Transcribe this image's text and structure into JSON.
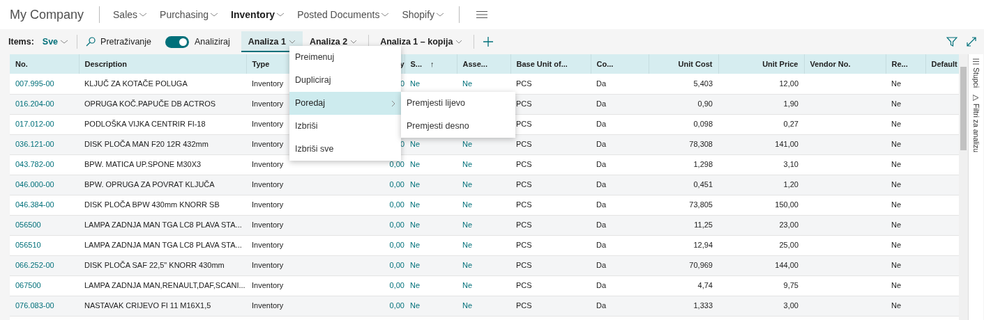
{
  "header": {
    "company": "My Company",
    "nav": [
      {
        "label": "Sales",
        "selected": false
      },
      {
        "label": "Purchasing",
        "selected": false
      },
      {
        "label": "Inventory",
        "selected": true
      },
      {
        "label": "Posted Documents",
        "selected": false
      },
      {
        "label": "Shopify",
        "selected": false
      }
    ]
  },
  "toolbar": {
    "items_label": "Items:",
    "view": "Sve",
    "search": "Pretraživanje",
    "analyze": {
      "label": "Analiziraj",
      "on": true
    },
    "tabs": [
      {
        "label": "Analiza 1",
        "selected": true
      },
      {
        "label": "Analiza 2",
        "selected": false
      },
      {
        "label": "Analiza 1 – kopija",
        "selected": false
      }
    ]
  },
  "menu": {
    "items": [
      {
        "label": "Preimenuj",
        "selected": false,
        "submenu": false
      },
      {
        "label": "Dupliciraj",
        "selected": false,
        "submenu": false
      },
      {
        "label": "Poredaj",
        "selected": true,
        "submenu": true
      },
      {
        "label": "Izbriši",
        "selected": false,
        "submenu": false
      },
      {
        "label": "Izbriši sve",
        "selected": false,
        "submenu": false
      }
    ],
    "submenu": [
      "Premjesti lijevo",
      "Premjesti desno"
    ]
  },
  "side_panel": [
    "Stupci",
    "Filtri za analizu"
  ],
  "table": {
    "columns": [
      {
        "label": "No.",
        "kind": "link"
      },
      {
        "label": "Description",
        "kind": "text"
      },
      {
        "label": "Type",
        "kind": "text"
      },
      {
        "label": "y",
        "kind": "linknumber"
      },
      {
        "label": "S...",
        "kind": "link",
        "sort_mark": "↑"
      },
      {
        "label": "Asse...",
        "kind": "link"
      },
      {
        "label": "Base Unit of...",
        "kind": "text"
      },
      {
        "label": "Co...",
        "kind": "text"
      },
      {
        "label": "Unit Cost",
        "kind": "number"
      },
      {
        "label": "Unit Price",
        "kind": "number"
      },
      {
        "label": "Vendor No.",
        "kind": "text"
      },
      {
        "label": "Re...",
        "kind": "text"
      },
      {
        "label": "Default",
        "kind": "text"
      }
    ],
    "rows": [
      [
        "007.995-00",
        "KLJUČ ZA KOTAČE POLUGA",
        "Inventory",
        "0",
        "Ne",
        "Ne",
        "PCS",
        "Da",
        "5,403",
        "12,00",
        null,
        "Ne",
        null
      ],
      [
        "016.204-00",
        "OPRUGA KOČ.PAPUČE DB ACTROS",
        "Inventory",
        null,
        null,
        null,
        "PCS",
        "Da",
        "0,90",
        "1,90",
        null,
        "Ne",
        null
      ],
      [
        "017.012-00",
        "PODLOŠKA VIJKA CENTRIR FI-18",
        "Inventory",
        null,
        null,
        null,
        "PCS",
        "Da",
        "0,098",
        "0,27",
        null,
        "Ne",
        null
      ],
      [
        "036.121-00",
        "DISK PLOČA MAN F20 12R 432mm",
        "Inventory",
        "0",
        "Ne",
        "Ne",
        "PCS",
        "Da",
        "78,308",
        "141,00",
        null,
        "Ne",
        null
      ],
      [
        "043.782-00",
        "BPW. MATICA UP.SPONE M30X3",
        "Inventory",
        "0,00",
        "Ne",
        "Ne",
        "PCS",
        "Da",
        "1,298",
        "3,10",
        null,
        "Ne",
        null
      ],
      [
        "046.000-00",
        "BPW. OPRUGA ZA POVRAT KLJUČA",
        "Inventory",
        "0,00",
        "Ne",
        "Ne",
        "PCS",
        "Da",
        "0,451",
        "1,20",
        null,
        "Ne",
        null
      ],
      [
        "046.384-00",
        "DISK PLOČA BPW 430mm KNORR SB",
        "Inventory",
        "0,00",
        "Ne",
        "Ne",
        "PCS",
        "Da",
        "73,805",
        "150,00",
        null,
        "Ne",
        null
      ],
      [
        "056500",
        "LAMPA ZADNJA MAN TGA LC8 PLAVA STA...",
        "Inventory",
        "0,00",
        "Ne",
        "Ne",
        "PCS",
        "Da",
        "11,25",
        "23,00",
        null,
        "Ne",
        null
      ],
      [
        "056510",
        "LAMPA ZADNJA MAN TGA LC8 PLAVA STA...",
        "Inventory",
        "0,00",
        "Ne",
        "Ne",
        "PCS",
        "Da",
        "12,94",
        "25,00",
        null,
        "Ne",
        null
      ],
      [
        "066.252-00",
        "DISK PLOČA SAF 22,5\" KNORR 430mm",
        "Inventory",
        "0,00",
        "Ne",
        "Ne",
        "PCS",
        "Da",
        "70,969",
        "144,00",
        null,
        "Ne",
        null
      ],
      [
        "067500",
        "LAMPA ZADNJA MAN,RENAULT,DAF,SCANI...",
        "Inventory",
        "0,00",
        "Ne",
        "Ne",
        "PCS",
        "Da",
        "4,74",
        "9,75",
        null,
        "Ne",
        null
      ],
      [
        "076.083-00",
        "NASTAVAK CRIJEVO FI 11 M16X1,5",
        "Inventory",
        "0,00",
        "Ne",
        "Ne",
        "PCS",
        "Da",
        "1,333",
        "3,00",
        null,
        "Ne",
        null
      ]
    ]
  }
}
